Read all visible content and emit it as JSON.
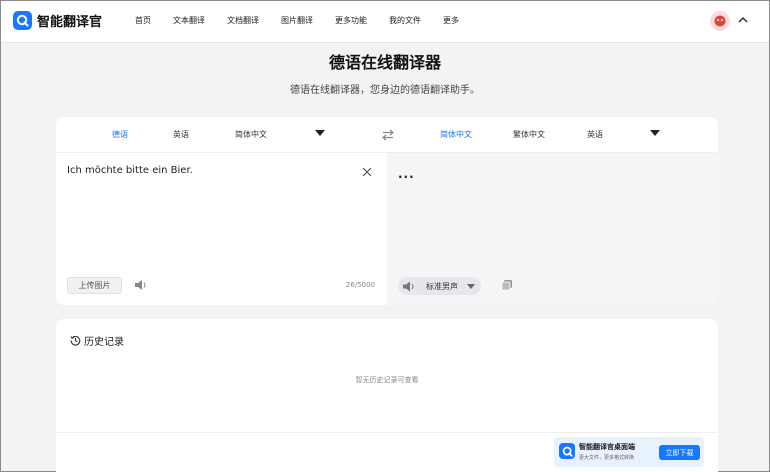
{
  "header": {
    "logo_text": "智能翻译官",
    "nav": [
      "首页",
      "文本翻译",
      "文档翻译",
      "图片翻译",
      "更多功能",
      "我的文件",
      "更多"
    ]
  },
  "hero": {
    "title": "德语在线翻译器",
    "subtitle": "德语在线翻译器，您身边的德语翻译助手。"
  },
  "source_langs": [
    "德语",
    "英语",
    "简体中文"
  ],
  "target_langs": [
    "简体中文",
    "繁体中文",
    "英语"
  ],
  "source": {
    "text": "Ich möchte bitte ein Bier.",
    "upload_label": "上传图片",
    "char_count": "26/5000"
  },
  "target": {
    "text": "...",
    "voice_label": "标准男声"
  },
  "history": {
    "title": "历史记录",
    "empty_text": "暂无历史记录可查看"
  },
  "promo": {
    "title": "智能翻译官桌面端",
    "subtitle": "更大文件，更多格式转换",
    "button": "立即下载"
  },
  "colors": {
    "accent": "#1677ff",
    "page_bg": "#f2f3f5",
    "target_pane_bg": "#f4f5f7"
  },
  "icons": [
    "logo-icon",
    "avatar-icon",
    "chevron-up-icon",
    "dropdown-icon",
    "swap-icon",
    "close-icon",
    "speaker-icon",
    "copy-icon",
    "history-icon"
  ]
}
